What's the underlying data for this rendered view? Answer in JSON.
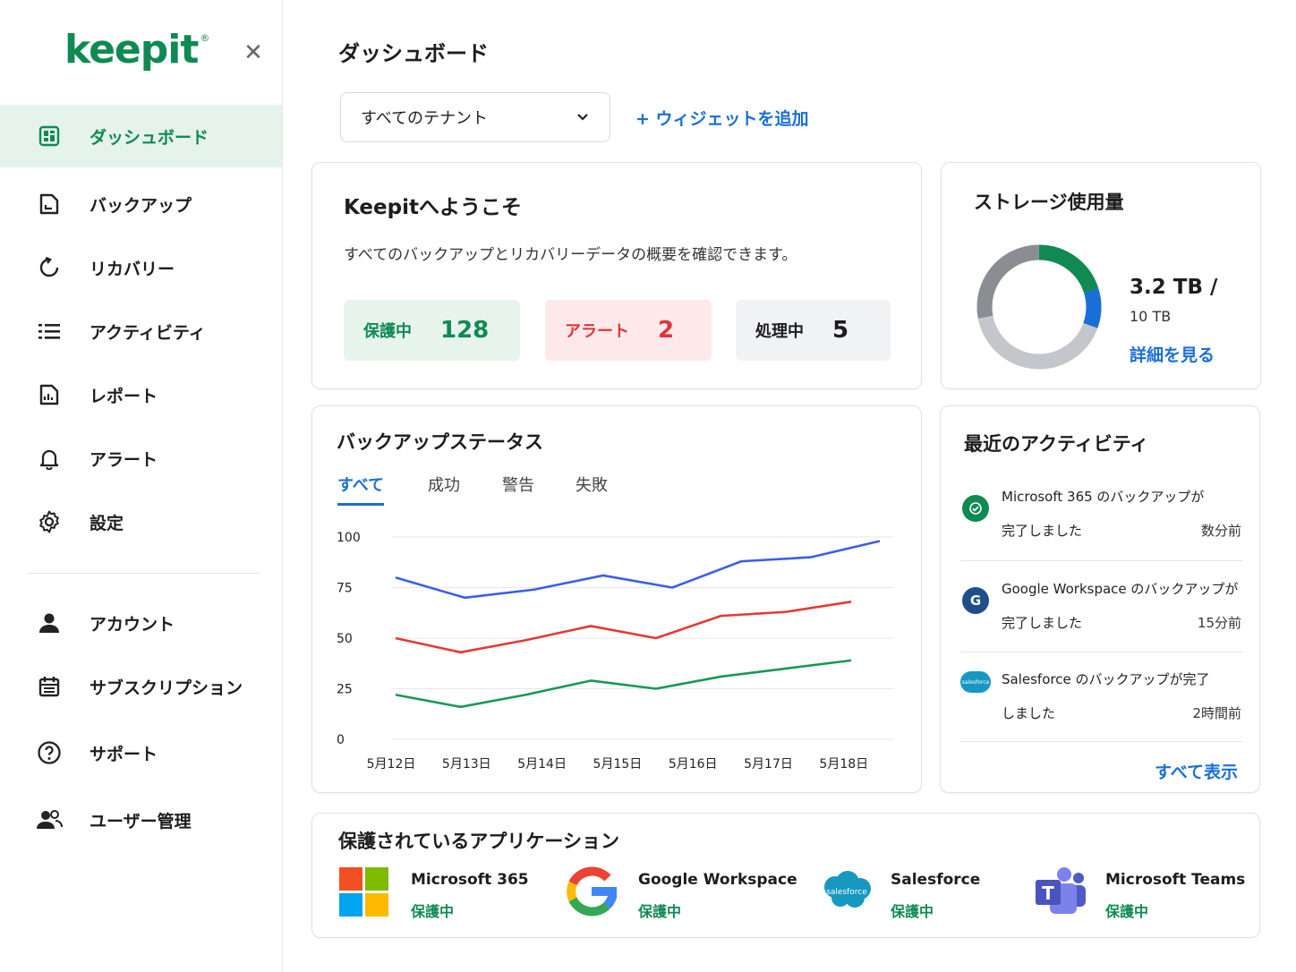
{
  "brand": {
    "logo": "keepit",
    "accent": "#0f8a52",
    "link": "#1a6fd6"
  },
  "sidebar": {
    "items": [
      {
        "label": "ダッシュボード",
        "icon": "dashboard-icon",
        "active": true
      },
      {
        "label": "バックアップ",
        "icon": "backup-file-icon"
      },
      {
        "label": "リカバリー",
        "icon": "recovery-icon"
      },
      {
        "label": "アクティビティ",
        "icon": "activity-list-icon"
      },
      {
        "label": "レポート",
        "icon": "report-icon"
      },
      {
        "label": "アラート",
        "icon": "bell-icon"
      },
      {
        "label": "設定",
        "icon": "gear-icon"
      }
    ],
    "bottom_items": [
      {
        "label": "アカウント",
        "icon": "user-icon"
      },
      {
        "label": "サブスクリプション",
        "icon": "calendar-icon"
      },
      {
        "label": "サポート",
        "icon": "help-icon"
      },
      {
        "label": "ユーザー管理",
        "icon": "users-icon"
      }
    ]
  },
  "header": {
    "title": "ダッシュボード",
    "tenant_select": "すべてのテナント",
    "add_widget": "+ ウィジェットを追加"
  },
  "welcome": {
    "title": "Keepitへようこそ",
    "subtitle": "すべてのバックアップとリカバリーデータの概要を確認できます。",
    "stats": [
      {
        "label": "保護中",
        "value": "128"
      },
      {
        "label": "アラート",
        "value": "2"
      },
      {
        "label": "処理中",
        "value": "5"
      }
    ]
  },
  "storage": {
    "title": "ストレージ使用量",
    "used": "3.2 TB /",
    "total": "10 TB",
    "details_link": "詳細を見る"
  },
  "backup_status": {
    "title": "バックアップステータス",
    "tabs": [
      "すべて",
      "成功",
      "警告",
      "失敗"
    ],
    "active_tab": 0
  },
  "chart_data": {
    "type": "line",
    "x": [
      "5月12日",
      "5月13日",
      "5月14日",
      "5月15日",
      "5月16日",
      "5月17日",
      "5月18日"
    ],
    "ylim": [
      0,
      100
    ],
    "yticks": [
      100,
      75,
      50,
      25,
      0
    ],
    "grid": true,
    "series": [
      {
        "color": "#3b5ee8",
        "values": [
          80,
          70,
          74,
          81,
          75,
          88,
          90,
          98
        ]
      },
      {
        "color": "#e53935",
        "values": [
          50,
          43,
          49,
          56,
          50,
          61,
          63,
          68
        ]
      },
      {
        "color": "#159a52",
        "values": [
          22,
          16,
          22,
          29,
          25,
          31,
          35,
          39
        ]
      }
    ]
  },
  "activity": {
    "title": "最近のアクティビティ",
    "items": [
      {
        "line1": "Microsoft 365 のバックアップが",
        "line2": "完了しました",
        "time": "数分前",
        "icon": "check-circle-icon",
        "glyph": "✓"
      },
      {
        "line1": "Google Workspace のバックアップが",
        "line2": "完了しました",
        "time": "15分前",
        "icon": "google-g-icon",
        "glyph": "G"
      },
      {
        "line1": "Salesforce のバックアップが完了",
        "line2": "しました",
        "time": "2時間前",
        "icon": "salesforce-cloud-icon",
        "glyph": "salesforce"
      }
    ],
    "show_all": "すべて表示"
  },
  "apps": {
    "title": "保護されているアプリケーション",
    "items": [
      {
        "name": "Microsoft 365",
        "status": "保護中",
        "icon": "microsoft-logo-icon"
      },
      {
        "name": "Google Workspace",
        "status": "保護中",
        "icon": "google-logo-icon"
      },
      {
        "name": "Salesforce",
        "status": "保護中",
        "icon": "salesforce-logo-icon",
        "glyph": "salesforce"
      },
      {
        "name": "Microsoft Teams",
        "status": "保護中",
        "icon": "teams-logo-icon",
        "glyph": "T"
      }
    ]
  }
}
